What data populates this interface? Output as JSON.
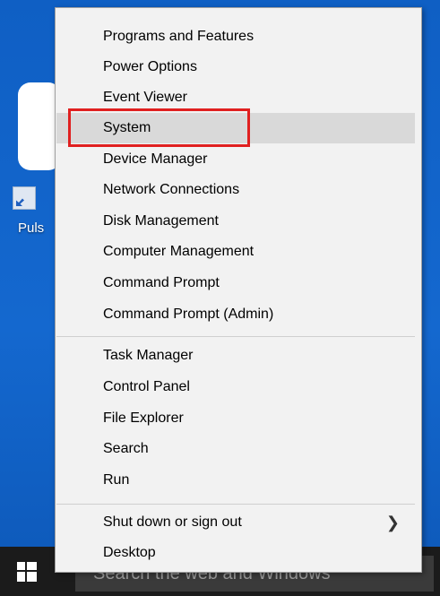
{
  "desktop": {
    "shortcut_label": "Puls",
    "shortcut_icon": "shortcut-arrow-icon"
  },
  "taskbar": {
    "start_icon": "windows-logo-icon",
    "search_placeholder": "Search the web and Windows"
  },
  "menu": {
    "group1": [
      {
        "label": "Programs and Features"
      },
      {
        "label": "Power Options"
      },
      {
        "label": "Event Viewer"
      },
      {
        "label": "System",
        "highlighted": true
      },
      {
        "label": "Device Manager"
      },
      {
        "label": "Network Connections"
      },
      {
        "label": "Disk Management"
      },
      {
        "label": "Computer Management"
      },
      {
        "label": "Command Prompt"
      },
      {
        "label": "Command Prompt (Admin)"
      }
    ],
    "group2": [
      {
        "label": "Task Manager"
      },
      {
        "label": "Control Panel"
      },
      {
        "label": "File Explorer"
      },
      {
        "label": "Search"
      },
      {
        "label": "Run"
      }
    ],
    "group3": [
      {
        "label": "Shut down or sign out",
        "submenu_icon": "chevron-right-icon"
      },
      {
        "label": "Desktop"
      }
    ],
    "annotation_color": "#e02020",
    "highlight_color": "#d9d9d9"
  }
}
